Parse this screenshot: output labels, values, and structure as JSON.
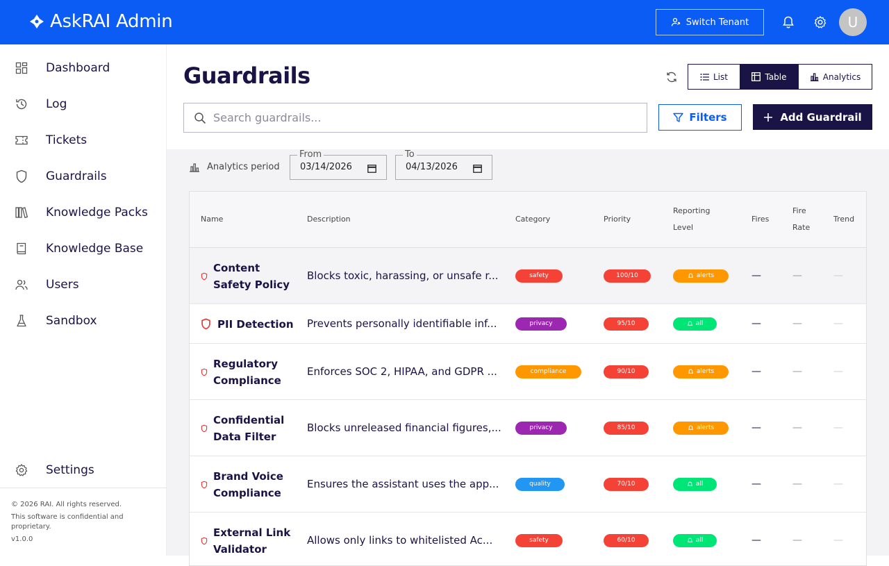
{
  "app": {
    "title": "AskRAI Admin"
  },
  "header": {
    "switch_tenant_label": "Switch Tenant",
    "avatar_initial": "U"
  },
  "sidebar": {
    "items": [
      {
        "label": "Dashboard",
        "icon": "grid-icon"
      },
      {
        "label": "Log",
        "icon": "history-icon"
      },
      {
        "label": "Tickets",
        "icon": "ticket-icon"
      },
      {
        "label": "Guardrails",
        "icon": "shield-icon"
      },
      {
        "label": "Knowledge Packs",
        "icon": "books-icon"
      },
      {
        "label": "Knowledge Base",
        "icon": "book-icon"
      },
      {
        "label": "Users",
        "icon": "users-icon"
      },
      {
        "label": "Sandbox",
        "icon": "flask-icon"
      }
    ],
    "settings_label": "Settings",
    "footer": {
      "copyright": "© 2026 RAI. All rights reserved.",
      "confidential_line1": "This software is confidential and",
      "confidential_line2": "proprietary.",
      "version": "v1.0.0"
    }
  },
  "page": {
    "title": "Guardrails",
    "view_options": [
      "List",
      "Table",
      "Analytics"
    ],
    "active_view": "Table",
    "search_placeholder": "Search guardrails...",
    "filters_label": "Filters",
    "add_label": "Add Guardrail"
  },
  "analytics": {
    "label": "Analytics period",
    "from_label": "From",
    "from_value": "03/14/2026",
    "to_label": "To",
    "to_value": "04/13/2026"
  },
  "table": {
    "columns": {
      "name": "Name",
      "description": "Description",
      "category": "Category",
      "priority": "Priority",
      "reporting_level_1": "Reporting",
      "reporting_level_2": "Level",
      "fires": "Fires",
      "fire_rate_1": "Fire",
      "fire_rate_2": "Rate",
      "trend": "Trend"
    },
    "rows": [
      {
        "name_line1": "Content",
        "name_line2": "Safety Policy",
        "description": "Blocks toxic, harassing, or unsafe r...",
        "category": "safety",
        "priority": "100/10",
        "reporting": "alerts",
        "fires": "—",
        "fire_rate": "—",
        "trend": "—"
      },
      {
        "name_line1": "PII Detection",
        "name_line2": "",
        "description": "Prevents personally identifiable inf...",
        "category": "privacy",
        "priority": "95/10",
        "reporting": "all",
        "fires": "—",
        "fire_rate": "—",
        "trend": "—"
      },
      {
        "name_line1": "Regulatory",
        "name_line2": "Compliance",
        "description": "Enforces SOC 2, HIPAA, and GDPR ...",
        "category": "compliance",
        "priority": "90/10",
        "reporting": "alerts",
        "fires": "—",
        "fire_rate": "—",
        "trend": "—"
      },
      {
        "name_line1": "Confidential",
        "name_line2": "Data Filter",
        "description": "Blocks unreleased financial figures,...",
        "category": "privacy",
        "priority": "85/10",
        "reporting": "alerts",
        "fires": "—",
        "fire_rate": "—",
        "trend": "—"
      },
      {
        "name_line1": "Brand Voice",
        "name_line2": "Compliance",
        "description": "Ensures the assistant uses the app...",
        "category": "quality",
        "priority": "70/10",
        "reporting": "all",
        "fires": "—",
        "fire_rate": "—",
        "trend": "—"
      },
      {
        "name_line1": "External Link",
        "name_line2": "Validator",
        "description": "Allows only links to whitelisted Ac...",
        "category": "safety",
        "priority": "60/10",
        "reporting": "all",
        "fires": "—",
        "fire_rate": "—",
        "trend": "—"
      }
    ]
  },
  "colors": {
    "brand_blue": "#0a5cf5",
    "navy": "#1a1446",
    "safety": "#f44336",
    "privacy": "#9c27b0",
    "compliance": "#ff9800",
    "quality": "#2196f3",
    "priority": "#f44336",
    "alerts": "#ff9800",
    "all": "#00e676"
  }
}
